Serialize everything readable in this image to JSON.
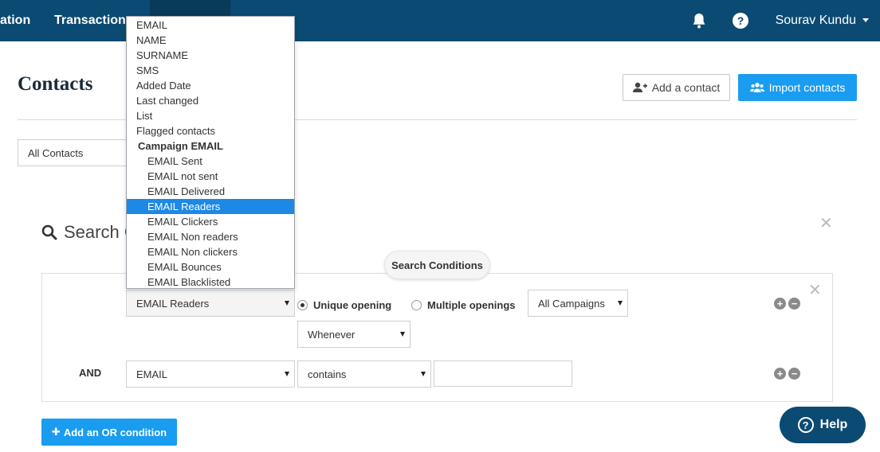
{
  "nav": {
    "links": [
      "ation",
      "Transaction"
    ],
    "user_name": "Sourav Kundu"
  },
  "page": {
    "title": "Contacts",
    "add_contact_label": "Add a contact",
    "import_contacts_label": "Import contacts"
  },
  "filter": {
    "list_select_value": "All Contacts"
  },
  "search": {
    "title": "Search C",
    "conditions_pill": "Search Conditions"
  },
  "condition_rows": [
    {
      "field_value": "EMAIL Readers",
      "radio_unique": "Unique opening",
      "radio_multiple": "Multiple openings",
      "campaign_value": "All Campaigns",
      "period_value": "Whenever"
    },
    {
      "connector": "AND",
      "field_value": "EMAIL",
      "operator_value": "contains",
      "text_value": ""
    }
  ],
  "field_dropdown": {
    "options": [
      {
        "label": "EMAIL",
        "level": 0
      },
      {
        "label": "NAME",
        "level": 0
      },
      {
        "label": "SURNAME",
        "level": 0
      },
      {
        "label": "SMS",
        "level": 0
      },
      {
        "label": "Added Date",
        "level": 0
      },
      {
        "label": "Last changed",
        "level": 0
      },
      {
        "label": "List",
        "level": 0
      },
      {
        "label": "Flagged contacts",
        "level": 0
      },
      {
        "label": "Campaign EMAIL",
        "level": "group"
      },
      {
        "label": "EMAIL Sent",
        "level": 1
      },
      {
        "label": "EMAIL not sent",
        "level": 1
      },
      {
        "label": "EMAIL Delivered",
        "level": 1
      },
      {
        "label": "EMAIL Readers",
        "level": 1,
        "selected": true
      },
      {
        "label": "EMAIL Clickers",
        "level": 1
      },
      {
        "label": "EMAIL Non readers",
        "level": 1
      },
      {
        "label": "EMAIL Non clickers",
        "level": 1
      },
      {
        "label": "EMAIL Bounces",
        "level": 1
      },
      {
        "label": "EMAIL Blacklisted",
        "level": 1
      }
    ]
  },
  "actions": {
    "add_or_label": "Add an OR condition",
    "help_label": "Help"
  },
  "icons": {
    "bell": "bell-icon",
    "question": "question-icon",
    "add_user": "add-user-icon",
    "users": "users-icon",
    "search": "search-icon",
    "close": "close-icon",
    "plus": "plus-icon",
    "minus": "minus-icon"
  },
  "colors": {
    "nav_bg": "#0b4a72",
    "primary": "#1a9cf0",
    "selected_option": "#1e88e5"
  }
}
